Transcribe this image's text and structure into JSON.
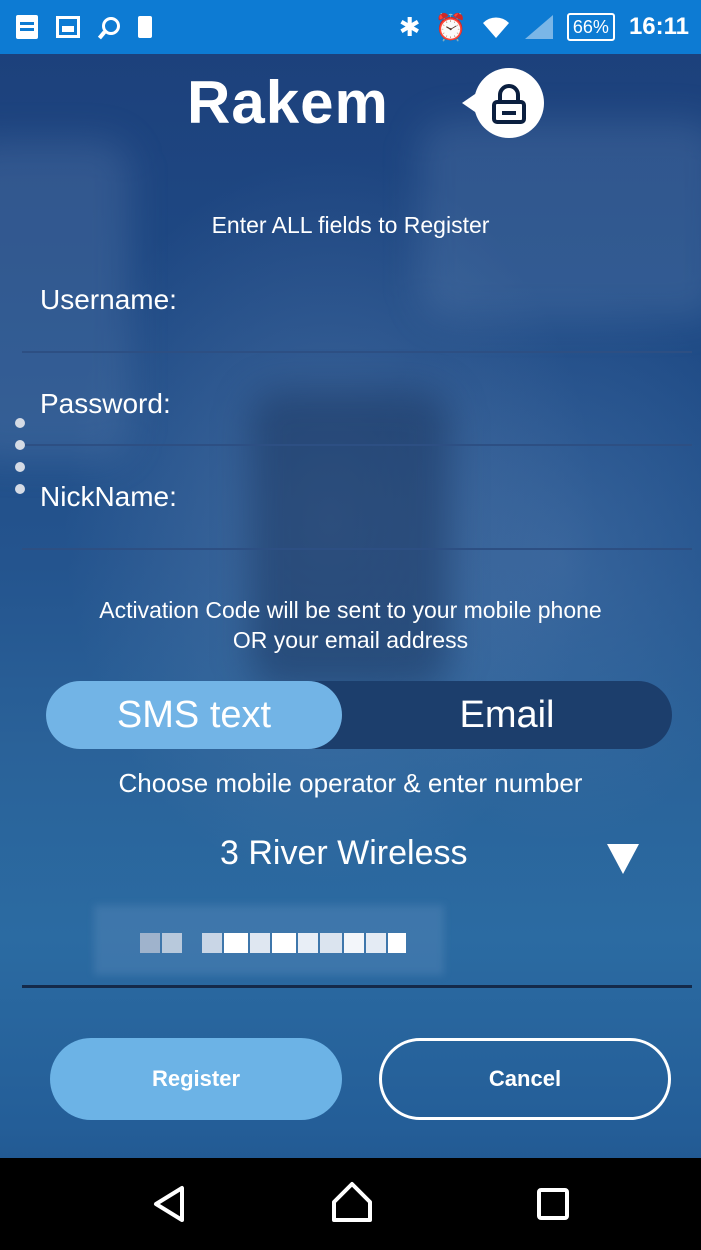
{
  "status_bar": {
    "left_icons": [
      "notes-icon",
      "image-icon",
      "search-icon",
      "phone-icon"
    ],
    "right_icons": [
      "bluetooth-icon",
      "alarm-icon",
      "wifi-icon",
      "signal-icon"
    ],
    "bluetooth_glyph": "✱",
    "alarm_glyph": "⏰",
    "battery": "66%",
    "time": "16:11"
  },
  "header": {
    "app_name": "Rakem",
    "logo_icon": "lock-icon"
  },
  "form": {
    "instruction": "Enter ALL fields to Register",
    "fields": [
      {
        "label": "Username:",
        "value": ""
      },
      {
        "label": "Password:",
        "value": ""
      },
      {
        "label": "NickName:",
        "value": ""
      }
    ],
    "activation_notice_line1": "Activation Code will be sent to your mobile phone",
    "activation_notice_line2": "OR your email address",
    "delivery_toggle": {
      "options": [
        "SMS text",
        "Email"
      ],
      "selected": "SMS text"
    },
    "operator_prompt": "Choose mobile operator & enter number",
    "operator": {
      "selected": "3 River Wireless",
      "dropdown_icon": "triangle-down-icon"
    },
    "phone_number": {
      "value_obscured": true
    }
  },
  "buttons": {
    "register": "Register",
    "cancel": "Cancel"
  },
  "nav": {
    "back": "back-icon",
    "home": "home-icon",
    "recents": "recents-icon"
  },
  "colors": {
    "status_bar": "#0d7bd3",
    "accent": "#6cb3e6",
    "toggle_track": "#1c3e6c",
    "background_top": "#1c3f7a",
    "background_bottom": "#2b6ba2"
  }
}
